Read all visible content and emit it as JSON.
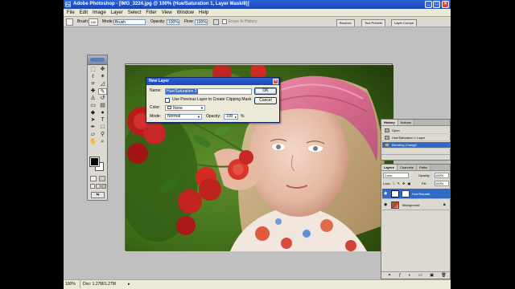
{
  "window": {
    "title": "Adobe Photoshop - [IMG_3224.jpg @ 100% (Hue/Saturation 1, Layer Mask/8)]",
    "controls": [
      "_",
      "□",
      "×"
    ]
  },
  "menu": [
    "File",
    "Edit",
    "Image",
    "Layer",
    "Select",
    "Filter",
    "View",
    "Window",
    "Help"
  ],
  "options_bar": {
    "brush_label": "Brush:",
    "brush_size": "100",
    "mode_label": "Mode:",
    "mode_value": "Brush",
    "opacity_label": "Opacity:",
    "opacity_value": "100%",
    "flow_label": "Flow:",
    "flow_value": "100%",
    "erase_label": "Erase to History",
    "palette_tabs": [
      "Brushes",
      "Tool Presets",
      "Layer Comps"
    ]
  },
  "dialog": {
    "title": "New Layer",
    "name_label": "Name:",
    "name_value": "Hue/Saturation 2",
    "ok_label": "OK",
    "cancel_label": "Cancel",
    "clip_label": "Use Previous Layer to Create Clipping Mask",
    "color_label": "Color:",
    "color_value": "None",
    "mode_label": "Mode:",
    "mode_value": "Normal",
    "opacity_label": "Opacity:",
    "opacity_value": "100",
    "opacity_unit": "%"
  },
  "history": {
    "tabs": [
      "History",
      "Actions"
    ],
    "items": [
      "Open",
      "Hue/Saturation 1 Layer",
      "Blending Change"
    ],
    "selected_index": 2
  },
  "layers": {
    "tabs": [
      "Layers",
      "Channels",
      "Paths"
    ],
    "blend_mode": "Color",
    "opacity_label": "Opacity:",
    "opacity_value": "100%",
    "lock_label": "Lock:",
    "fill_label": "Fill:",
    "fill_value": "100%",
    "items": [
      {
        "name": "Hue/Saturati...",
        "selected": true
      },
      {
        "name": "Background",
        "selected": false
      }
    ]
  },
  "status": {
    "zoom": "100%",
    "doc": "Doc: 1.27M/1.27M"
  },
  "colors": {
    "title_blue": "#1f52c8",
    "selection_blue": "#316ac5",
    "workspace_gray": "#c0c0c0"
  }
}
